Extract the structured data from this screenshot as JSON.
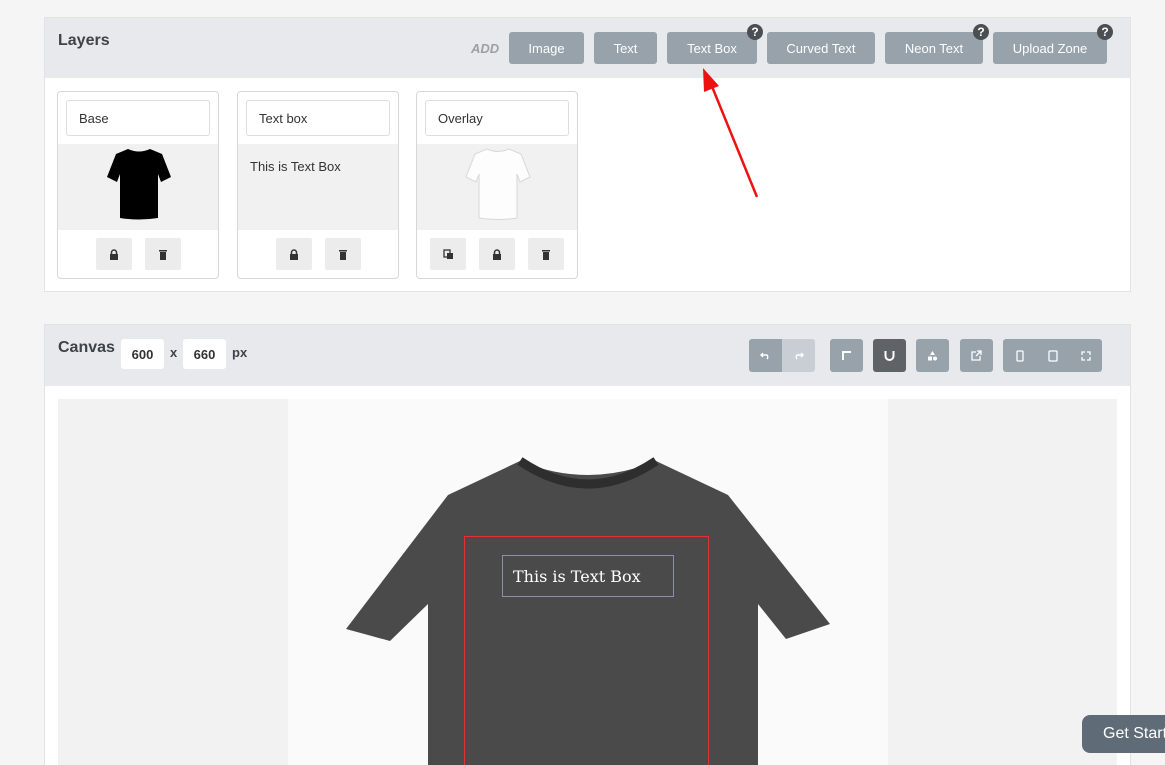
{
  "layers": {
    "title": "Layers",
    "add_label": "ADD",
    "buttons": [
      {
        "label": "Image",
        "help": false
      },
      {
        "label": "Text",
        "help": false
      },
      {
        "label": "Text Box",
        "help": true
      },
      {
        "label": "Curved Text",
        "help": false
      },
      {
        "label": "Neon Text",
        "help": true
      },
      {
        "label": "Upload Zone",
        "help": true
      }
    ],
    "help_glyph": "?",
    "cards": [
      {
        "name": "Base",
        "preview": "black-tshirt"
      },
      {
        "name": "Text box",
        "preview_text": "This is Text Box"
      },
      {
        "name": "Overlay",
        "preview": "white-tshirt"
      }
    ]
  },
  "canvas": {
    "title": "Canvas",
    "width": "600",
    "height": "660",
    "x": "x",
    "unit": "px",
    "textbox_text": "This is Text Box",
    "tshirt_color": "#4a4a4a",
    "print_area_color": "#dd3333"
  },
  "cta": {
    "label": "Get Started"
  },
  "colors": {
    "accent_button": "#97a2aa",
    "annotation_arrow": "#ee1111"
  }
}
